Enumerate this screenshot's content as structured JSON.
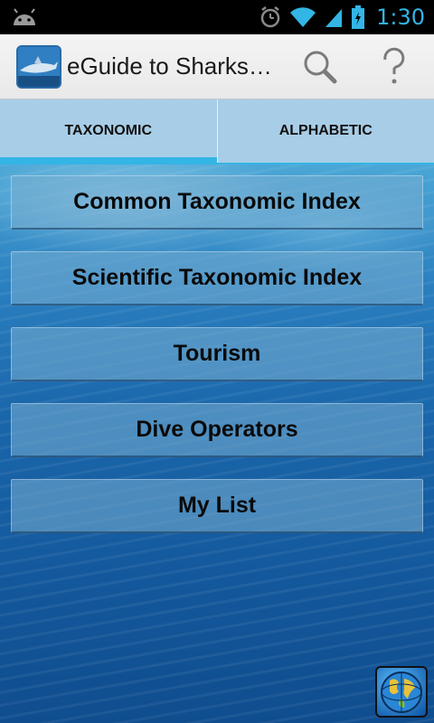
{
  "status_bar": {
    "time": "1:30",
    "icons": [
      "android-icon",
      "alarm-icon",
      "wifi-icon",
      "signal-icon",
      "battery-icon"
    ]
  },
  "action_bar": {
    "title": "eGuide to Sharks…",
    "icons": [
      "app-shark-icon",
      "search-icon",
      "help-icon"
    ]
  },
  "tabs": [
    {
      "label": "TAXONOMIC",
      "active": true
    },
    {
      "label": "ALPHABETIC",
      "active": false
    }
  ],
  "menu": {
    "items": [
      {
        "label": "Common Taxonomic Index"
      },
      {
        "label": "Scientific Taxonomic Index"
      },
      {
        "label": "Tourism"
      },
      {
        "label": "Dive Operators"
      },
      {
        "label": "My List"
      }
    ]
  },
  "corner_icon": "globe-icon",
  "colors": {
    "accent": "#33b5e5",
    "status_bar_bg": "#000000",
    "action_bar_bg": "#efefef",
    "ocean_top": "#4ba7d6",
    "ocean_bottom": "#0f4d8e"
  }
}
